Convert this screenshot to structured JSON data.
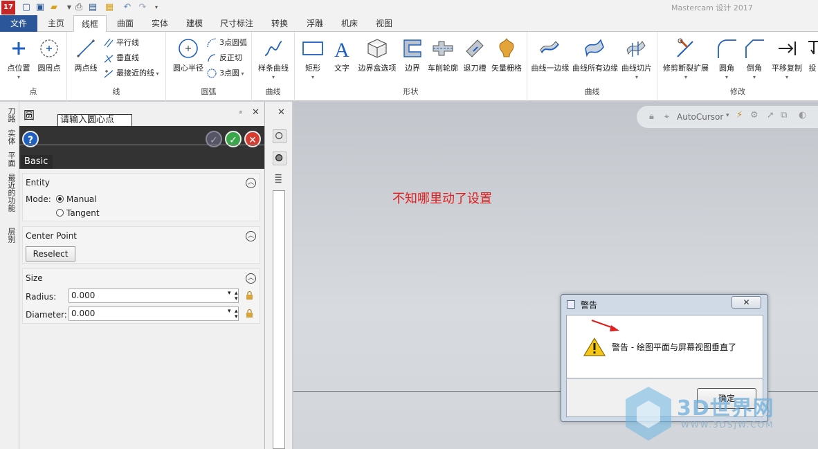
{
  "app": {
    "logo_text": "17",
    "window_title": "Mastercam 设计 2017"
  },
  "tabs": [
    {
      "label": "文件"
    },
    {
      "label": "主页"
    },
    {
      "label": "线框"
    },
    {
      "label": "曲面"
    },
    {
      "label": "实体"
    },
    {
      "label": "建模"
    },
    {
      "label": "尺寸标注"
    },
    {
      "label": "转换"
    },
    {
      "label": "浮雕"
    },
    {
      "label": "机床"
    },
    {
      "label": "视图"
    }
  ],
  "ribbon": {
    "groups": {
      "point": "点",
      "line": "线",
      "arc": "圆弧",
      "spline": "曲线",
      "shape": "形状",
      "curve": "曲线",
      "modify": "修改"
    },
    "buttons": {
      "point_position": "点位置",
      "circle_point": "圆周点",
      "two_point_line": "两点线",
      "parallel_line": "平行线",
      "perpendicular_line": "垂直线",
      "closest_line": "最接近的线",
      "circle_center_radius": "圆心半径",
      "three_point_arc": "3点圆弧",
      "tangent_arc": "反正切",
      "three_point_circle": "3点圆",
      "spline_curve": "样条曲线",
      "rectangle": "矩形",
      "text": "文字",
      "bounding_box": "边界盒选项",
      "boundary": "边界",
      "lathe_profile": "车削轮廓",
      "relief_groove": "退刀槽",
      "vector_grid": "矢量栅格",
      "curve_one_edge": "曲线一边缘",
      "curve_all_edges": "曲线所有边缘",
      "curve_slice": "曲线切片",
      "trim_break_extend": "修剪断裂扩展",
      "fillet": "圆角",
      "chamfer": "倒角",
      "translate_copy": "平移复制",
      "project": "投"
    }
  },
  "side_tabs": [
    "刀路",
    "实体",
    "平面",
    "最近的功能",
    "层别"
  ],
  "panel": {
    "title": "圆",
    "pin": "ᵖ",
    "close": "✕",
    "tooltip": "请输入圆心点",
    "help": "?",
    "basic_tab": "Basic",
    "entity": {
      "title": "Entity",
      "mode_label": "Mode:",
      "options": [
        "Manual",
        "Tangent"
      ],
      "selected": "Manual"
    },
    "center_point": {
      "title": "Center Point",
      "reselect": "Reselect"
    },
    "size": {
      "title": "Size",
      "radius_label": "Radius:",
      "radius_value": "0.000",
      "diameter_label": "Diameter:",
      "diameter_value": "0.000"
    }
  },
  "midcol": {
    "close": "✕"
  },
  "viewport": {
    "autocursor_label": "AutoCursor",
    "annotation": "不知哪里动了设置"
  },
  "dialog": {
    "title": "警告",
    "close": "✕",
    "message": "警告 - 绘图平面与屏幕视图垂直了",
    "ok": "确定"
  },
  "watermark": {
    "text": "3D世界网",
    "url": "WWW.3DSJW.COM"
  },
  "colors": {
    "file_tab": "#2b579a",
    "annotation": "#e01e1e",
    "panel_dark": "#333333",
    "ok_green": "#3aa64a",
    "cancel_red": "#d63b2f"
  }
}
